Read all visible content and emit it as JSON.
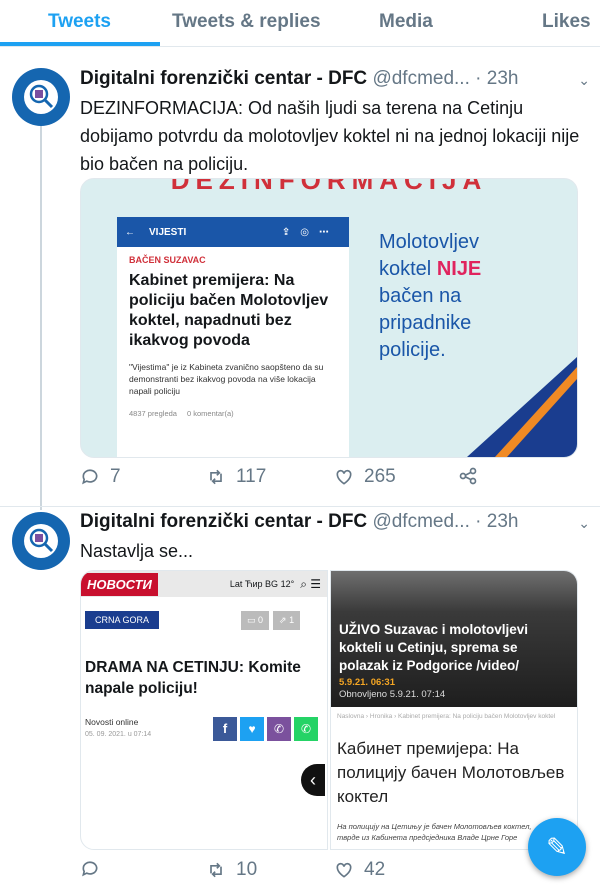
{
  "tabs": [
    "Tweets",
    "Tweets & replies",
    "Media",
    "Likes"
  ],
  "tweets": [
    {
      "name": "Digitalni forenzički centar - DFC",
      "handle": "@dfcmed...",
      "time": "· 23h",
      "text": "DEZINFORMACIJA: Od naših ljudi sa terena na Cetinju dobijamo potvrdu da molotovljev koktel ni na jednoj lokaciji nije bio bačen na policiju.",
      "card": {
        "top_strip": "DEZINFORMACIJA",
        "phone": {
          "section": "VIJESTI",
          "kicker": "BAČEN SUZAVAC",
          "headline": "Kabinet premijera: Na policiju bačen Molotovljev koktel, napadnuti bez ikakvog povoda",
          "body": "\"Vijestima\" je iz Kabineta zvanično saopšteno da su demonstranti bez ikakvog povoda na više lokacija napali policiju",
          "views": "4837 pregleda",
          "comments": "0 komentar(a)"
        },
        "claim_before": "Molotovljev koktel ",
        "claim_highlight": "NIJE",
        "claim_after": " bačen na pripadnike policije."
      },
      "replies": "7",
      "retweets": "117",
      "likes": "265"
    },
    {
      "name": "Digitalni forenzički centar - DFC",
      "handle": "@dfcmed...",
      "time": "· 23h",
      "text": "Nastavlja se...",
      "left_card": {
        "logo": "НОВОСТИ",
        "lang": "Lat Ћир BG 12°",
        "tag": "CRNA GORA",
        "comments": "0",
        "shares": "1",
        "headline": "DRAMA NA CETINJU: Komite napale policiju!",
        "source": "Novosti online",
        "date": "05. 09. 2021. u 07:14"
      },
      "right_card": {
        "headline": "UŽIVO Suzavac i molotovljevi kokteli u Cetinju, sprema se polazak iz Podgorice /video/",
        "date": "5.9.21. 06:31",
        "updated": "Obnovljeno 5.9.21. 07:14",
        "breadcrumb": "Naslovna  ›  Hronika  ›  Kabinet premijera: Na policiju bačen Molotovljev koktel",
        "headline2": "Кабинет премијера: На полицију бачен Молотовљев коктел",
        "lede": "На полицију на Цетињу је бачен Молотовљев коктел, тврде из Кабинета предсједника Владе Црне Горе"
      },
      "replies": "",
      "retweets": "10",
      "likes": "42"
    }
  ],
  "colors": {
    "accent": "#1da1f2",
    "muted": "#657786",
    "card_blue": "#1a56a8",
    "claim_red": "#e0245e"
  }
}
